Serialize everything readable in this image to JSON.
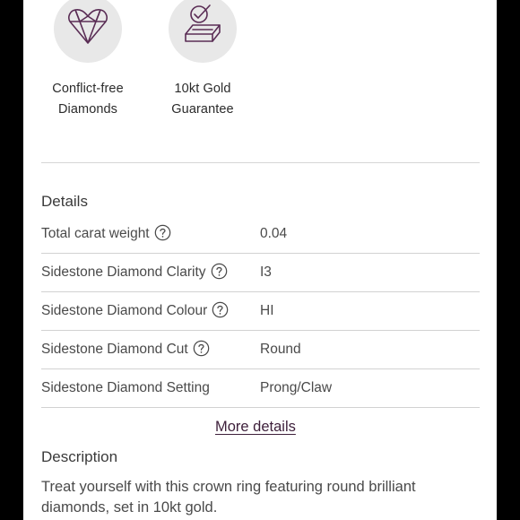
{
  "badges": [
    {
      "icon": "heart-diamond-icon",
      "line1": "Conflict-free",
      "line2": "Diamonds"
    },
    {
      "icon": "gold-bar-check-icon",
      "line1": "10kt Gold",
      "line2": "Guarantee"
    }
  ],
  "details": {
    "title": "Details",
    "rows": [
      {
        "label": "Total carat weight",
        "value": "0.04"
      },
      {
        "label": "Sidestone Diamond Clarity",
        "value": "I3"
      },
      {
        "label": "Sidestone Diamond Colour",
        "value": "HI"
      },
      {
        "label": "Sidestone Diamond Cut",
        "value": "Round"
      },
      {
        "label": "Sidestone Diamond Setting",
        "value": "Prong/Claw"
      }
    ],
    "more_link": "More details"
  },
  "description": {
    "title": "Description",
    "text": "Treat yourself with this crown ring featuring round brilliant diamonds, set in 10kt gold."
  },
  "colors": {
    "icon_stroke": "#5a2d55",
    "badge_bg": "#e8e8e8",
    "link": "#3d1f3a",
    "text": "#4a4a4a"
  }
}
